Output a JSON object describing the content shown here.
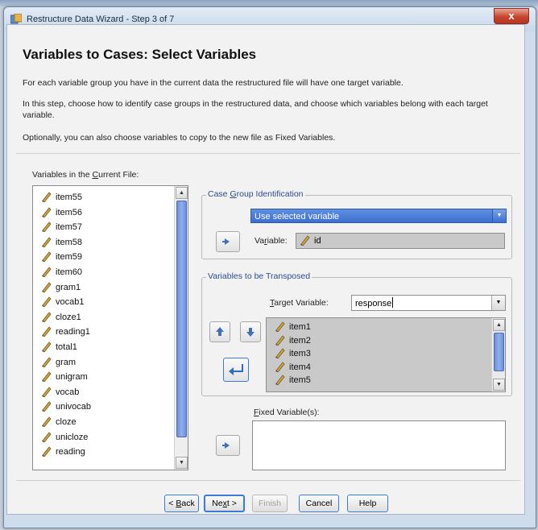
{
  "window": {
    "title": "Restructure Data Wizard - Step 3 of 7",
    "close_glyph": "x"
  },
  "page": {
    "heading": "Variables to Cases: Select Variables",
    "paragraph1": "For each variable group you have in the current data the restructured file will have one target variable.",
    "paragraph2": "In this step, choose how to identify case groups in the restructured data, and choose which variables belong with each target variable.",
    "paragraph3": "Optionally, you can also choose variables to copy to the new file as Fixed Variables."
  },
  "current_vars": {
    "label_pre": "Variables in the ",
    "label_ul": "C",
    "label_post": "urrent File:",
    "items": [
      "item55",
      "item56",
      "item57",
      "item58",
      "item59",
      "item60",
      "gram1",
      "vocab1",
      "cloze1",
      "reading1",
      "total1",
      "gram",
      "unigram",
      "vocab",
      "univocab",
      "cloze",
      "unicloze",
      "reading"
    ]
  },
  "case_group": {
    "title_pre": "Case ",
    "title_ul": "G",
    "title_post": "roup Identification",
    "selected_option": "Use selected variable",
    "var_label_pre": "Va",
    "var_label_ul": "r",
    "var_label_post": "iable:",
    "var_value": "id"
  },
  "transposed": {
    "title": "Variables to be Transposed",
    "target_label_ul": "T",
    "target_label_post": "arget Variable:",
    "target_value": "response",
    "items": [
      "item1",
      "item2",
      "item3",
      "item4",
      "item5"
    ]
  },
  "fixed": {
    "label_ul": "F",
    "label_post": "ixed Variable(s):"
  },
  "buttons": {
    "back_prefix": "< ",
    "back_ul": "B",
    "back_post": "ack",
    "next_pre": "Ne",
    "next_ul": "x",
    "next_post": "t >",
    "finish": "Finish",
    "cancel": "Cancel",
    "help": "Help"
  },
  "colors": {
    "accent": "#3d7ad6",
    "selection": "#c9c9c9",
    "group_title": "#2a4c8d",
    "close": "#c7452f"
  },
  "icons": {
    "arrow_button": "right-arrow-icon",
    "variable": "pencil-scale-icon",
    "up": "up-arrow-icon",
    "down": "down-arrow-icon",
    "enter": "enter-arrow-icon"
  }
}
